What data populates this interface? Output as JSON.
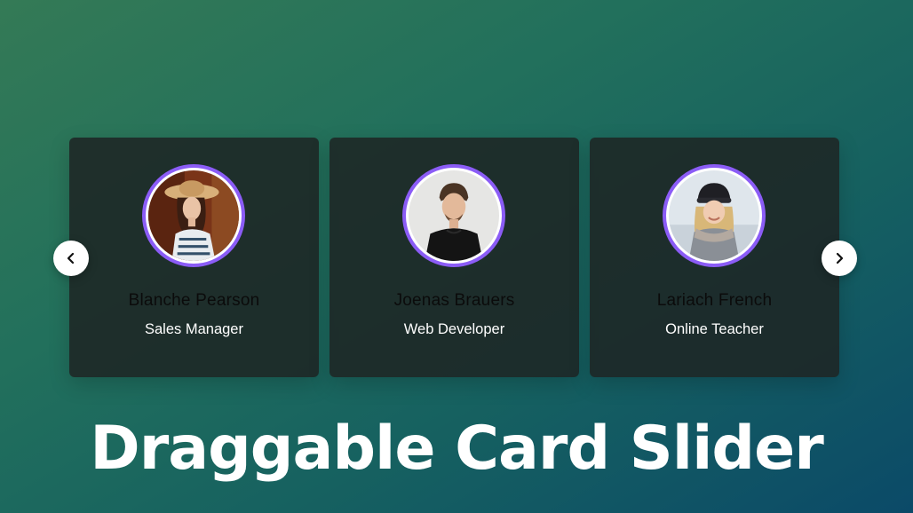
{
  "page": {
    "title": "Draggable Card Slider"
  },
  "slider": {
    "prev_icon": "chevron-left-icon",
    "next_icon": "chevron-right-icon",
    "cards": [
      {
        "name": "Blanche Pearson",
        "role": "Sales Manager"
      },
      {
        "name": "Joenas Brauers",
        "role": "Web Developer"
      },
      {
        "name": "Lariach French",
        "role": "Online Teacher"
      }
    ]
  },
  "colors": {
    "accent": "#8b5cf6",
    "card_bg": "#1e2624",
    "name_text": "#0b0b0b",
    "role_text": "#ffffff"
  }
}
